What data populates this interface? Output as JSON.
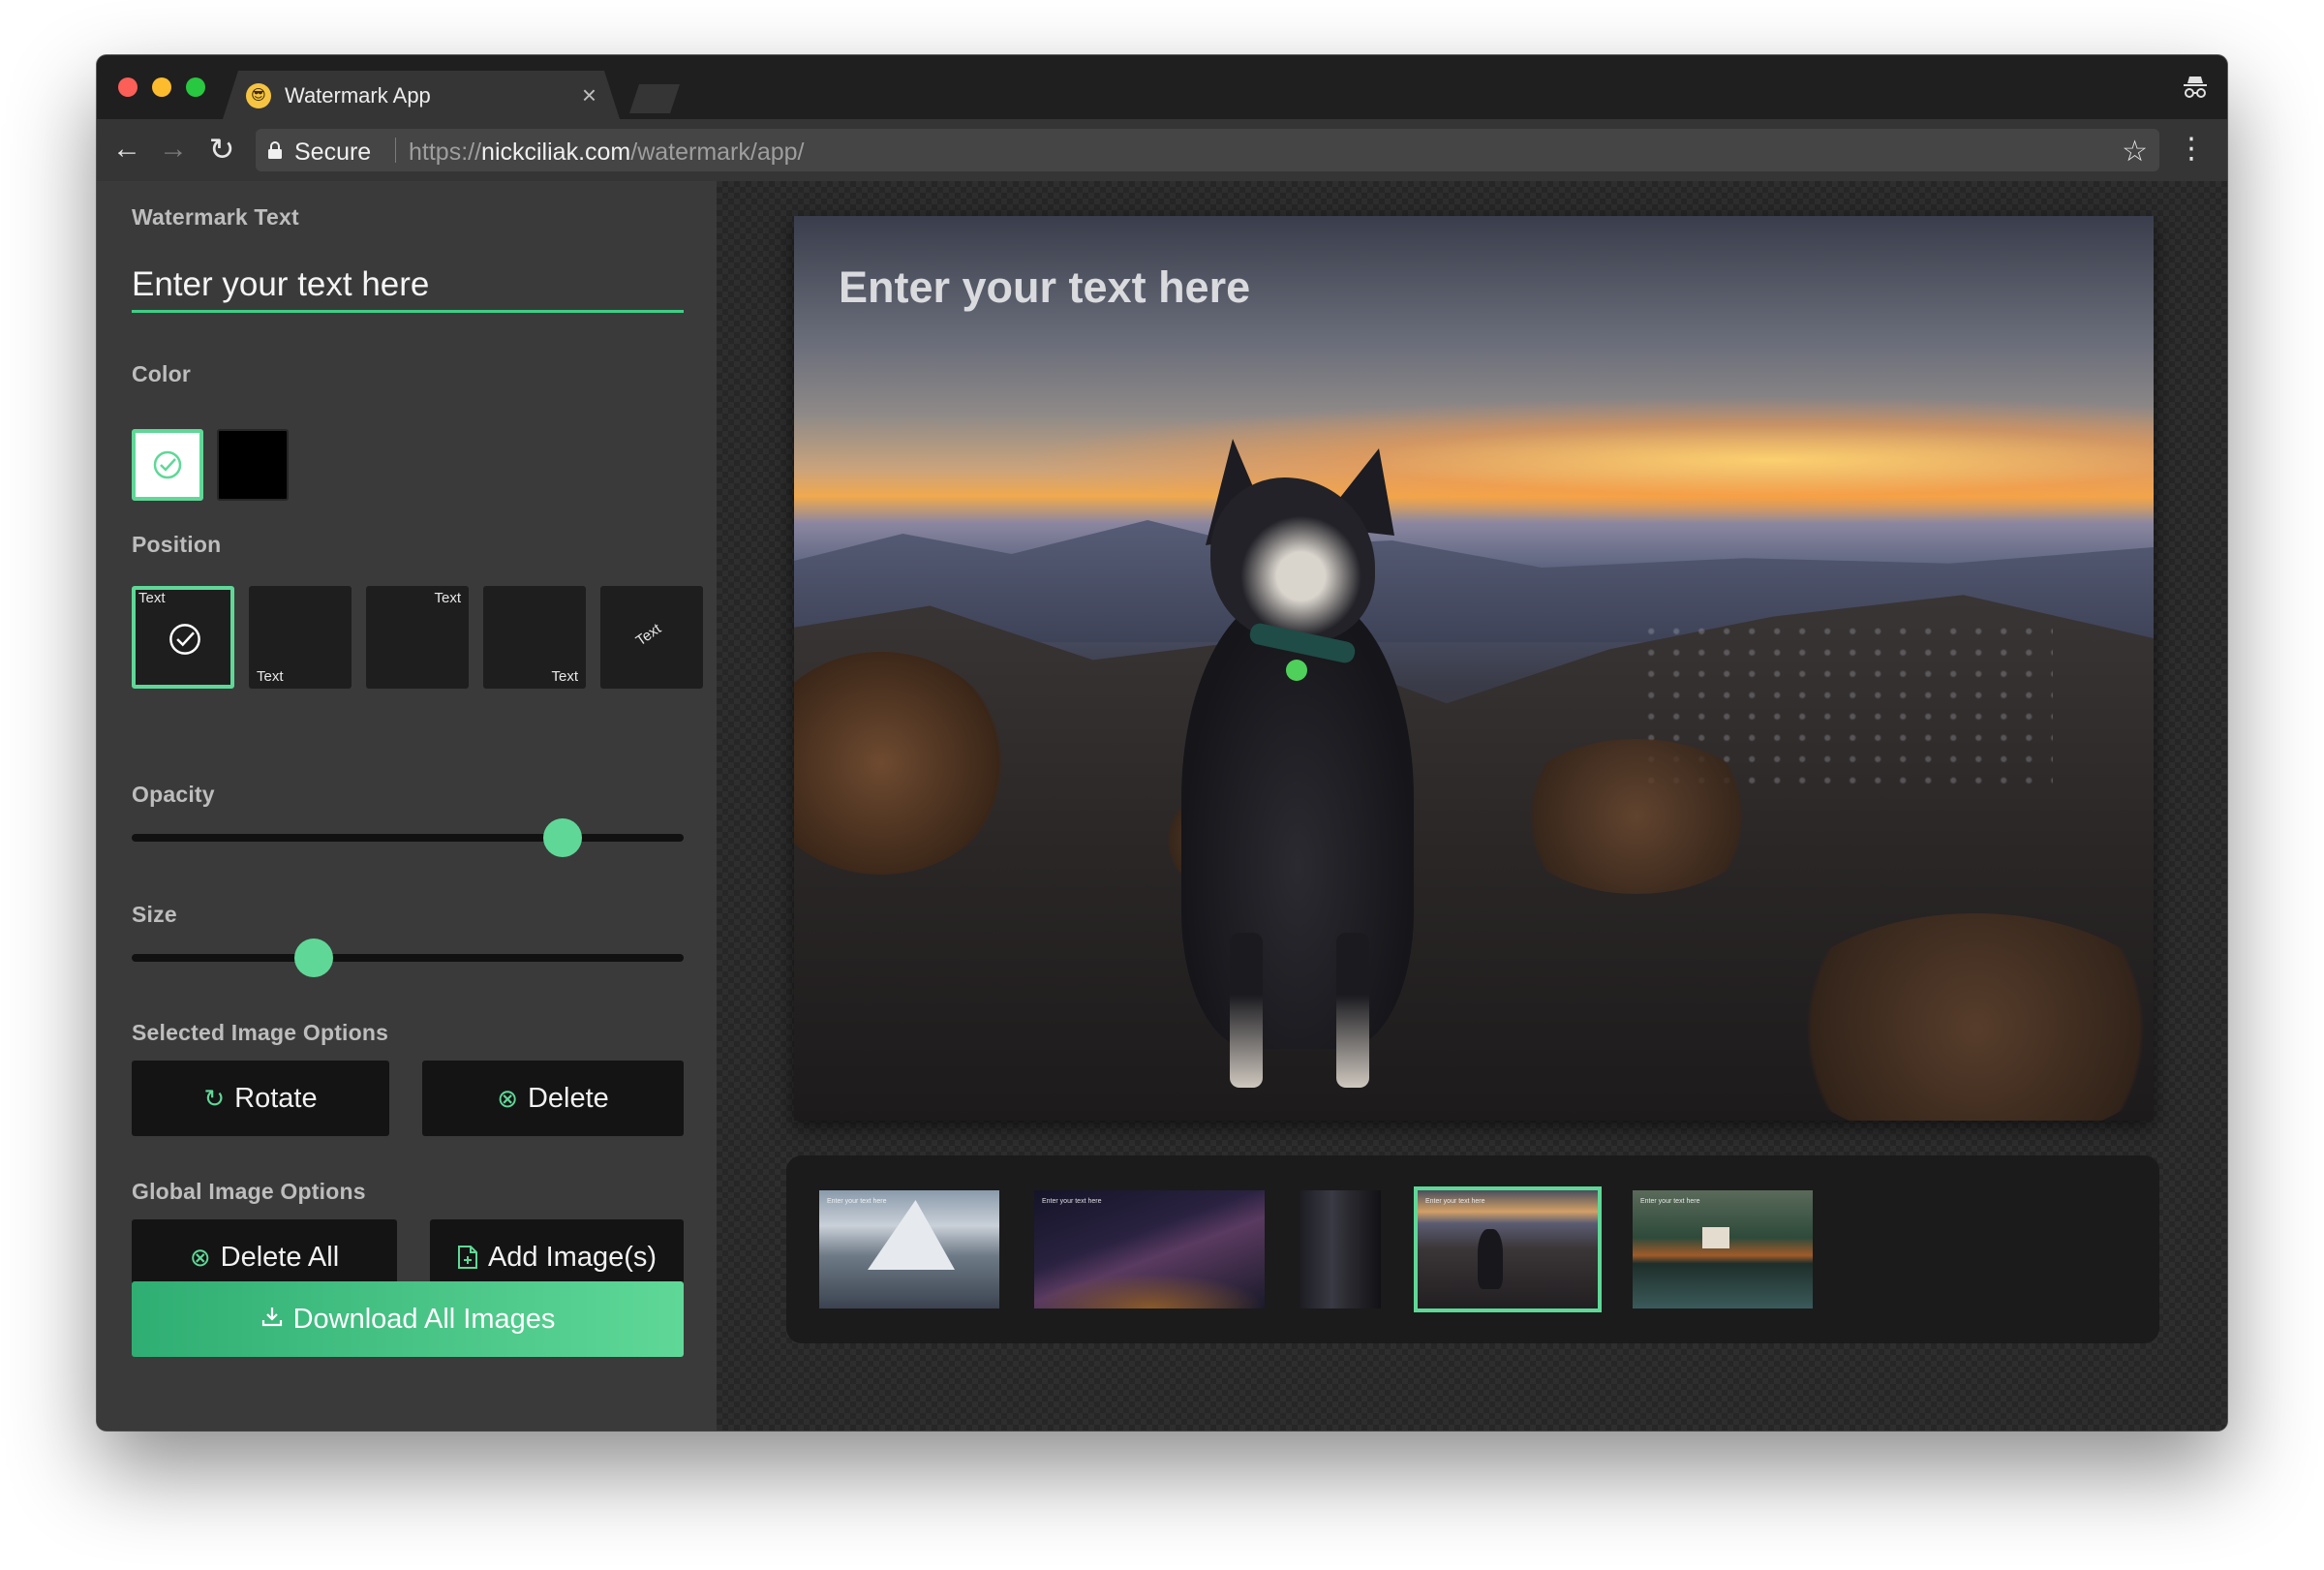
{
  "browser": {
    "tab_title": "Watermark App",
    "tab_favicon": "sunglasses-emoji-icon",
    "tab_close": "×",
    "secure_label": "Secure",
    "url_scheme": "https://",
    "url_host": "nickciliak.com",
    "url_path": "/watermark/app/",
    "icons": [
      "back-arrow-icon",
      "forward-arrow-icon",
      "reload-icon",
      "lock-icon",
      "star-icon",
      "menu-dots-icon",
      "incognito-icon"
    ]
  },
  "sidebar": {
    "watermark_text_label": "Watermark Text",
    "text_input_placeholder": "Enter your text here",
    "color_label": "Color",
    "colors": [
      {
        "name": "white",
        "hex": "#ffffff",
        "selected": true
      },
      {
        "name": "black",
        "hex": "#000000",
        "selected": false
      }
    ],
    "position_label": "Position",
    "positions": [
      {
        "id": "top-left",
        "label": "Text",
        "selected": true
      },
      {
        "id": "bottom-left",
        "label": "Text",
        "selected": false
      },
      {
        "id": "top-right",
        "label": "Text",
        "selected": false
      },
      {
        "id": "bottom-right",
        "label": "Text",
        "selected": false
      },
      {
        "id": "center-diagonal",
        "label": "Text",
        "selected": false
      }
    ],
    "opacity_label": "Opacity",
    "opacity_value": 0.78,
    "size_label": "Size",
    "size_value": 0.33,
    "selected_image_options_label": "Selected Image Options",
    "rotate_label": "Rotate",
    "delete_label": "Delete",
    "global_image_options_label": "Global Image Options",
    "delete_all_label": "Delete All",
    "add_images_label": "Add Image(s)",
    "download_all_label": "Download All Images"
  },
  "stage": {
    "watermark_text": "Enter your text here",
    "thumbnails": [
      {
        "id": "mountain-peak",
        "mini_text": "Enter your text here",
        "selected": false
      },
      {
        "id": "milky-way",
        "mini_text": "Enter your text here",
        "selected": false
      },
      {
        "id": "building",
        "mini_text": "",
        "selected": false
      },
      {
        "id": "dog-sunset",
        "mini_text": "Enter your text here",
        "selected": true
      },
      {
        "id": "lake-house",
        "mini_text": "Enter your text here",
        "selected": false
      }
    ]
  },
  "colors": {
    "accent": "#5fd897",
    "sidebar_bg": "#3a3a3a",
    "button_bg": "#141414"
  }
}
